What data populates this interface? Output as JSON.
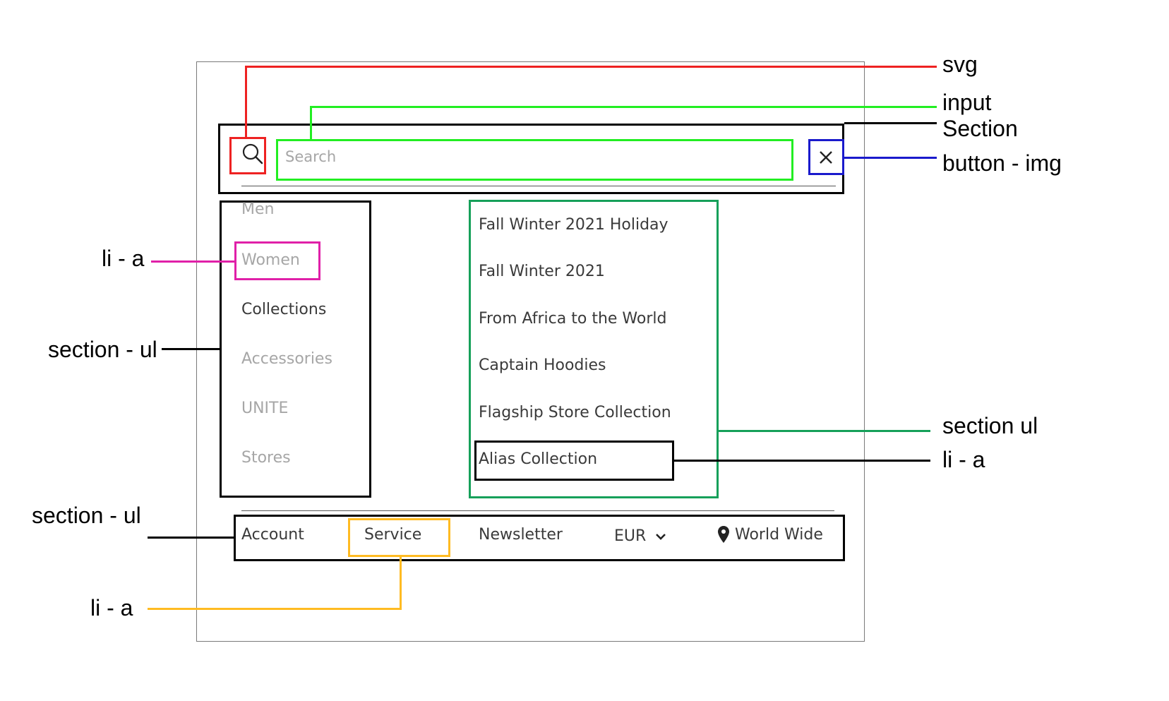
{
  "search": {
    "placeholder": "Search",
    "search_icon": "search-icon",
    "close_icon": "close-icon",
    "close_symbol": "×"
  },
  "categories": [
    {
      "label": "Men",
      "active": false
    },
    {
      "label": "Women",
      "active": false
    },
    {
      "label": "Collections",
      "active": true
    },
    {
      "label": "Accessories",
      "active": false
    },
    {
      "label": "UNITE",
      "active": false
    },
    {
      "label": "Stores",
      "active": false
    }
  ],
  "collections": [
    "Fall Winter 2021 Holiday",
    "Fall Winter 2021",
    "From Africa to the World",
    "Captain Hoodies",
    "Flagship Store Collection",
    "Alias Collection"
  ],
  "footer": {
    "account": "Account",
    "service": "Service",
    "newsletter": "Newsletter",
    "currency": "EUR",
    "currency_icon": "chevron-down-icon",
    "location_icon": "map-pin-icon",
    "location": "World Wide"
  },
  "annotations": {
    "svg": "svg",
    "input": "input",
    "section": "Section",
    "button_img": "button - img",
    "li_a_women": "li - a",
    "section_ul_left": "section - ul",
    "section_ul_right": "section ul",
    "li_a_alias": "li - a",
    "section_ul_footer": "section - ul",
    "li_a_service": "li - a"
  },
  "colors": {
    "svg": "#ee2222",
    "input": "#22ee22",
    "button_img": "#1a1acc",
    "li_a_women": "#e020a8",
    "section_ul_right": "#16a05a",
    "li_a_service": "#ffbb22",
    "structure": "#000000"
  }
}
